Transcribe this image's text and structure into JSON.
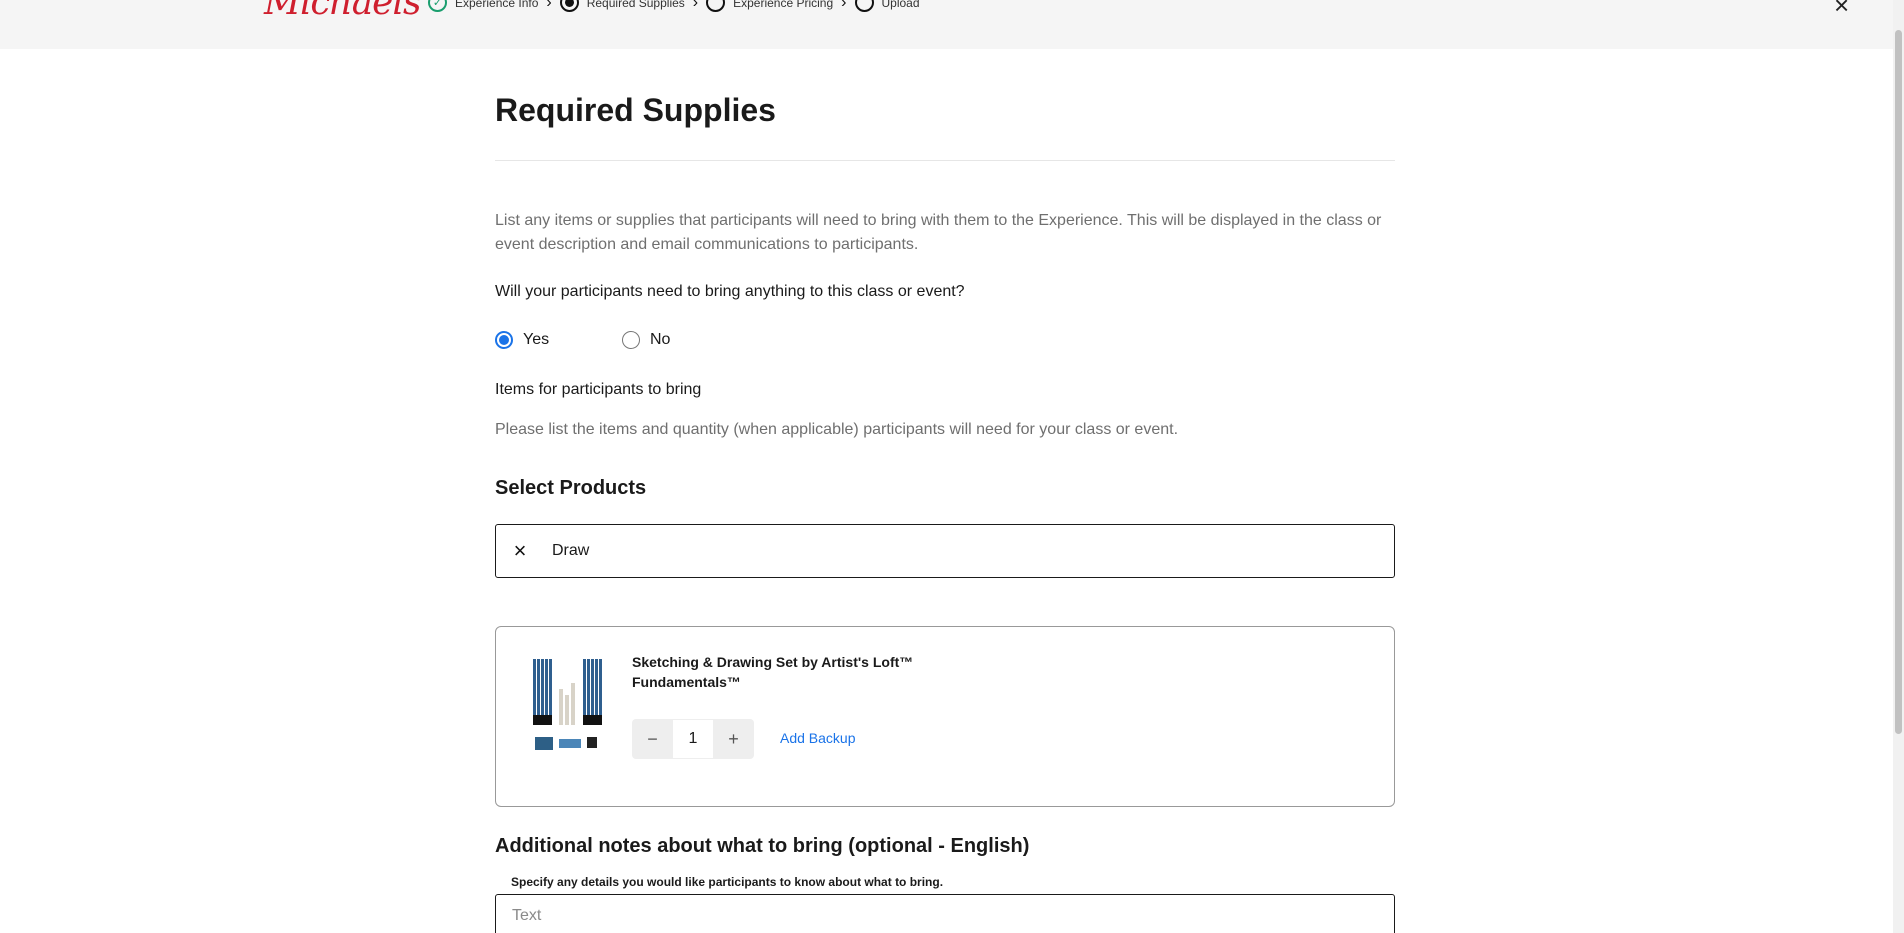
{
  "header": {
    "logo_text": "Michaels",
    "steps": [
      {
        "label": "Experience Info",
        "state": "done"
      },
      {
        "label": "Required Supplies",
        "state": "active"
      },
      {
        "label": "Experience Pricing",
        "state": "pending"
      },
      {
        "label": "Upload",
        "state": "pending"
      }
    ],
    "step_separator": "›",
    "close_icon": "×"
  },
  "page": {
    "title": "Required Supplies",
    "intro": "List any items or supplies that participants will need to bring with them to the Experience. This will be displayed in the class or event description and email communications to participants.",
    "question": "Will your participants need to bring anything to this class or event?",
    "options": [
      {
        "label": "Yes",
        "checked": true
      },
      {
        "label": "No",
        "checked": false
      }
    ],
    "items_label": "Items for participants to bring",
    "items_help": "Please list the items and quantity (when applicable) participants will need for your class or event."
  },
  "products": {
    "title": "Select Products",
    "search_value": "Draw",
    "clear_icon": "×",
    "result": {
      "name": "Sketching & Drawing Set by Artist's Loft™ Fundamentals™",
      "quantity": "1",
      "minus_label": "−",
      "plus_label": "+",
      "add_backup_label": "Add Backup"
    }
  },
  "notes": {
    "title": "Additional notes about what to bring (optional - English)",
    "help": "Specify any details you would like participants to know about what to bring.",
    "placeholder": "Text",
    "value": ""
  },
  "colors": {
    "brand": "#cf1f2e",
    "accent": "#1a73e8",
    "done": "#1a9e6e"
  }
}
